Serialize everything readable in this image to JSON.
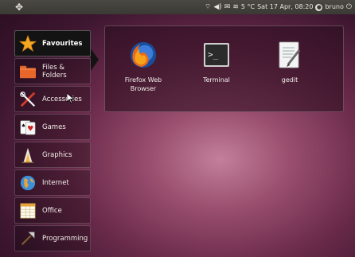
{
  "top_panel": {
    "network_icon": "wifi-icon",
    "volume_icon": "volume-icon",
    "mail_icon": "mail-icon",
    "weather_icon": "weather-icon",
    "temperature": "5 °C",
    "datetime": "Sat 17 Apr, 08:20",
    "user": "bruno",
    "power_icon": "power-icon"
  },
  "sidebar": {
    "items": [
      {
        "label": "Favourites",
        "icon": "star-icon",
        "active": true
      },
      {
        "label": "Files & Folders",
        "icon": "folder-icon",
        "active": false
      },
      {
        "label": "Accessories",
        "icon": "accessories-icon",
        "active": false
      },
      {
        "label": "Games",
        "icon": "cards-icon",
        "active": false
      },
      {
        "label": "Graphics",
        "icon": "graphics-icon",
        "active": false
      },
      {
        "label": "Internet",
        "icon": "globe-icon",
        "active": false
      },
      {
        "label": "Office",
        "icon": "office-icon",
        "active": false
      },
      {
        "label": "Programming",
        "icon": "trowel-icon",
        "active": false
      }
    ]
  },
  "apps": [
    {
      "label": "Firefox Web Browser",
      "icon": "firefox-icon"
    },
    {
      "label": "Terminal",
      "icon": "terminal-icon"
    },
    {
      "label": "gedit",
      "icon": "gedit-icon"
    }
  ]
}
